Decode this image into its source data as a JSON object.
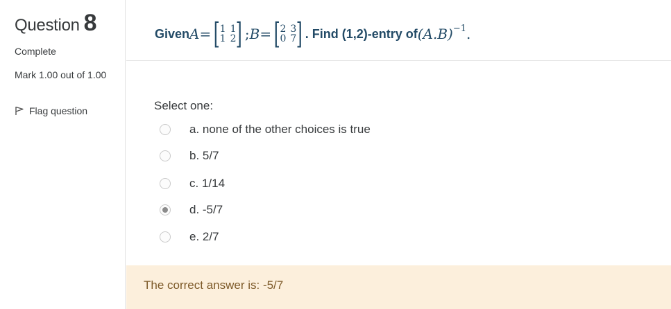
{
  "question": {
    "word": "Question",
    "number": "8",
    "state": "Complete",
    "grade": "Mark 1.00 out of 1.00",
    "flag_label": "Flag question"
  },
  "qtext": {
    "given": "Given ",
    "a_symbol": "A",
    "a_matrix": [
      "1",
      "1",
      "1",
      "2"
    ],
    "separator": ";",
    "b_symbol": "B",
    "b_matrix": [
      "2",
      "3",
      "0",
      "7"
    ],
    "find": ". Find (1,2)-entry of ",
    "expression": "(A.B)",
    "exponent": "−1",
    "end": "."
  },
  "answer": {
    "prompt": "Select one:",
    "options": [
      {
        "label": "a. none of the other choices is true",
        "checked": false
      },
      {
        "label": "b. 5/7",
        "checked": false
      },
      {
        "label": "c. 1/14",
        "checked": false
      },
      {
        "label": "d. -5/7",
        "checked": true
      },
      {
        "label": "e. 2/7",
        "checked": false
      }
    ]
  },
  "feedback": {
    "text": "The correct answer is: -5/7"
  }
}
